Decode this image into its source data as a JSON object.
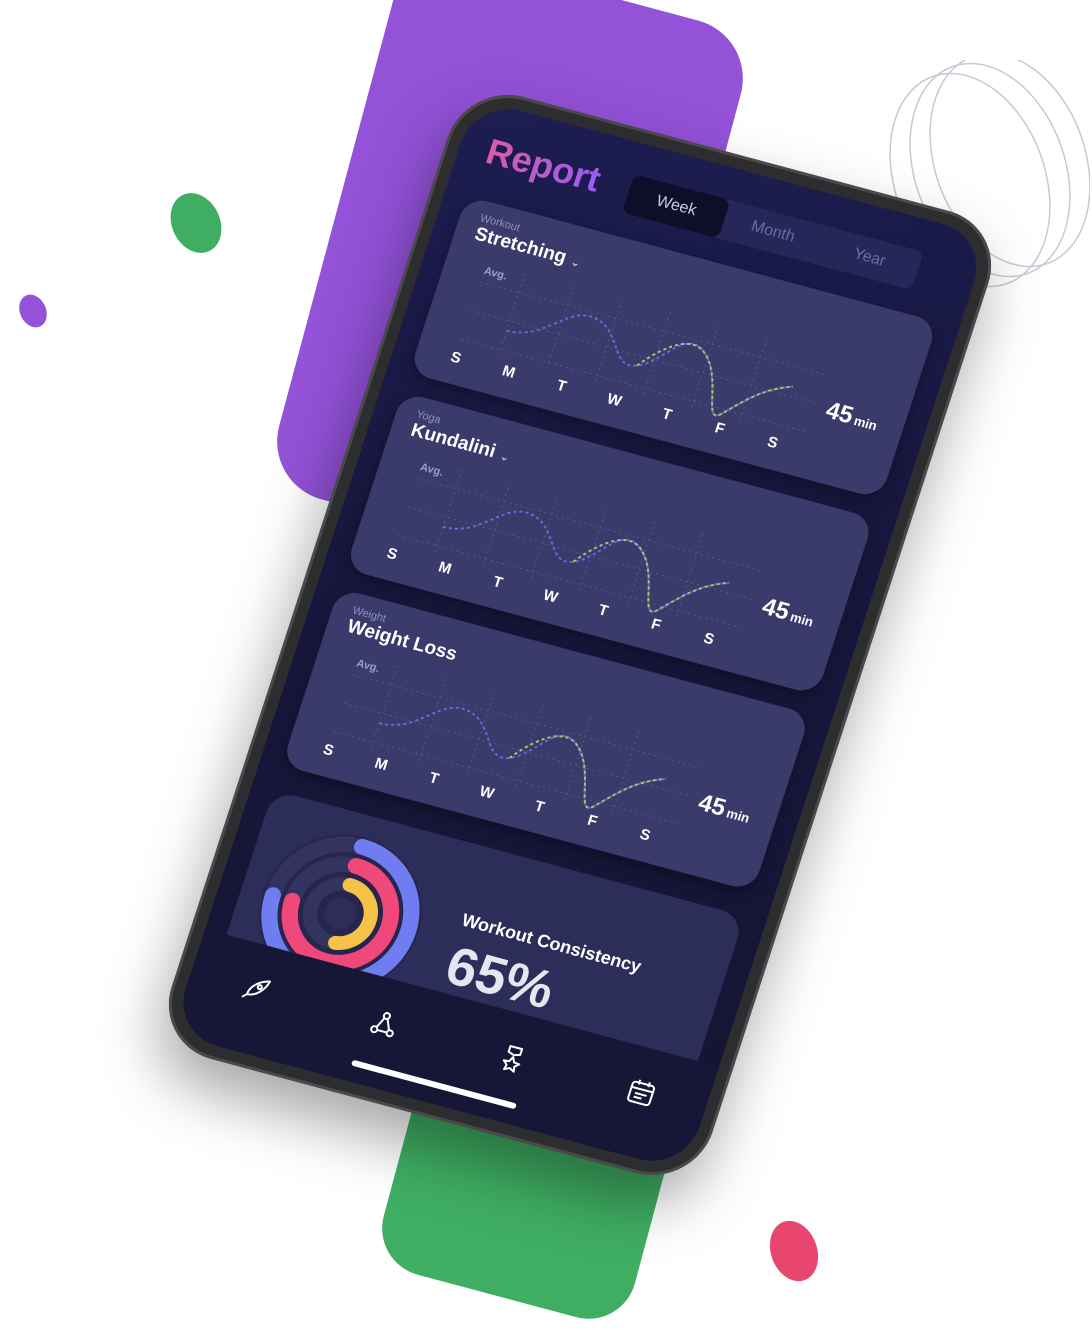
{
  "app": {
    "title": "Report"
  },
  "period_tabs": [
    {
      "label": "Week",
      "active": true
    },
    {
      "label": "Month",
      "active": false
    },
    {
      "label": "Year",
      "active": false
    }
  ],
  "cards": [
    {
      "category": "Workout",
      "name": "Stretching",
      "avg_label": "Avg.",
      "value": "45",
      "unit": "min",
      "days": [
        "S",
        "M",
        "T",
        "W",
        "T",
        "F",
        "S"
      ]
    },
    {
      "category": "Yoga",
      "name": "Kundalini",
      "avg_label": "Avg.",
      "value": "45",
      "unit": "min",
      "days": [
        "S",
        "M",
        "T",
        "W",
        "T",
        "F",
        "S"
      ]
    },
    {
      "category": "Weight",
      "name": "Weight Loss",
      "avg_label": "Avg.",
      "value": "45",
      "unit": "min",
      "days": [
        "S",
        "M",
        "T",
        "W",
        "T",
        "F",
        "S"
      ]
    }
  ],
  "consistency": {
    "title": "Workout Consistency",
    "value": "65%"
  },
  "nav": [
    {
      "icon": "rocket-icon"
    },
    {
      "icon": "share-icon"
    },
    {
      "icon": "award-icon"
    },
    {
      "icon": "calendar-icon"
    }
  ],
  "colors": {
    "purple": "#9352d8",
    "green": "#3fae62",
    "pink": "#e8466f",
    "screen_bg": "#1d1d52",
    "card_bg": "#3b3b6b",
    "ring_blue": "#6f7df0",
    "ring_pink": "#f0487a",
    "ring_yellow": "#f5c146"
  }
}
